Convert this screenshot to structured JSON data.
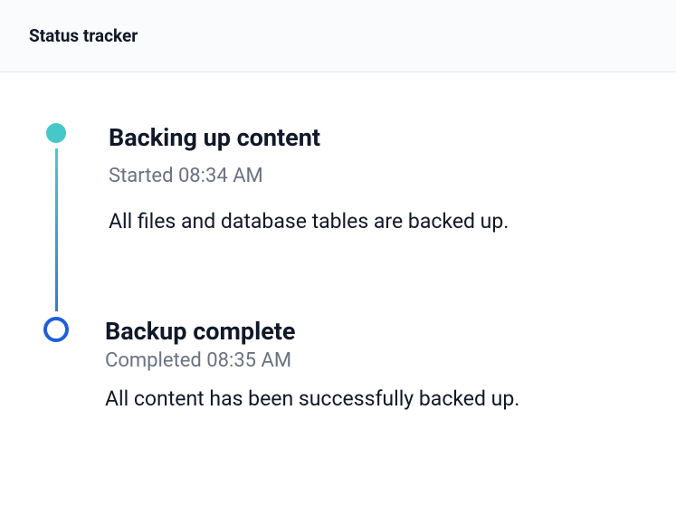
{
  "header": {
    "title": "Status tracker"
  },
  "timeline": {
    "steps": [
      {
        "title": "Backing up content",
        "subtitle": "Started 08:34 AM",
        "description": "All files and database tables are backed up."
      },
      {
        "title": "Backup complete",
        "subtitle": "Completed 08:35 AM",
        "description": "All content has been successfully backed up."
      }
    ]
  }
}
